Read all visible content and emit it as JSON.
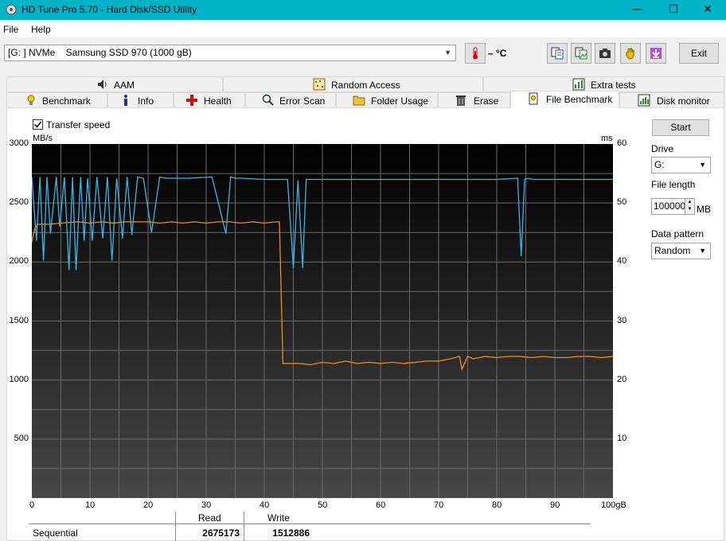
{
  "window": {
    "title": "HD Tune Pro 5.70 - Hard Disk/SSD Utility"
  },
  "menu": [
    "File",
    "Help"
  ],
  "toolbar": {
    "drive": "[G: ] NVMe    Samsung SSD 970 (1000 gB)",
    "temperature": "– °C",
    "exit_label": "Exit",
    "icons": [
      "thermometer-icon",
      "copy-text-icon",
      "copy-image-icon",
      "screenshot-icon",
      "hand-icon",
      "save-icon"
    ]
  },
  "tabs": {
    "row1": [
      {
        "label": "AAM",
        "icon": "speaker-icon"
      },
      {
        "label": "Random Access",
        "icon": "random-access-icon"
      },
      {
        "label": "Extra tests",
        "icon": "extra-tests-icon"
      }
    ],
    "row2": [
      {
        "label": "Benchmark",
        "icon": "benchmark-icon"
      },
      {
        "label": "Info",
        "icon": "info-icon"
      },
      {
        "label": "Health",
        "icon": "health-icon"
      },
      {
        "label": "Error Scan",
        "icon": "error-scan-icon"
      },
      {
        "label": "Folder Usage",
        "icon": "folder-icon"
      },
      {
        "label": "Erase",
        "icon": "erase-icon"
      },
      {
        "label": "File Benchmark",
        "icon": "file-benchmark-icon",
        "active": true
      },
      {
        "label": "Disk monitor",
        "icon": "disk-monitor-icon"
      }
    ]
  },
  "options": {
    "transfer_speed_label": "Transfer speed",
    "transfer_speed_checked": true
  },
  "side": {
    "start_label": "Start",
    "drive_label": "Drive",
    "drive_value": "G:",
    "file_length_label": "File length",
    "file_length_value": "100000",
    "file_length_unit": "MB",
    "pattern_label": "Data pattern",
    "pattern_value": "Random"
  },
  "chart_data": {
    "type": "line",
    "title": "",
    "left_unit": "MB/s",
    "right_unit": "ms",
    "x_unit": "gB",
    "ylim": [
      0,
      3000
    ],
    "y_right_lim": [
      0,
      60
    ],
    "xlim": [
      0,
      100
    ],
    "y_ticks": [
      3000,
      2500,
      2000,
      1500,
      1000,
      500
    ],
    "y_right_ticks": [
      60,
      50,
      40,
      30,
      20,
      10
    ],
    "x_ticks": [
      "0",
      "10",
      "20",
      "30",
      "40",
      "50",
      "60",
      "70",
      "80",
      "90",
      "100gB"
    ],
    "grid": true,
    "colors": {
      "read": "#3ab4e6",
      "write": "#f08c1e",
      "background_top": "#000000",
      "background_bottom": "#474747"
    },
    "series": [
      {
        "key": "read",
        "x": [
          0,
          0.8,
          1.4,
          2,
          2.6,
          3.2,
          4.2,
          4.8,
          5.6,
          6.4,
          7,
          7.6,
          8.4,
          9,
          9.6,
          10.4,
          11.2,
          12.2,
          13,
          13.8,
          14.6,
          15.6,
          16.4,
          17.2,
          18.2,
          19.2,
          20.6,
          22,
          23,
          24,
          27,
          31,
          33.4,
          34.2,
          35,
          36,
          40,
          44,
          45,
          45.8,
          46.6,
          47.2,
          50,
          60,
          70,
          80,
          83.6,
          84.2,
          84.8,
          85.4,
          86.2,
          90,
          100
        ],
        "values": [
          2720,
          2180,
          2720,
          2010,
          2720,
          2240,
          2720,
          2300,
          2720,
          1930,
          2720,
          1930,
          2720,
          2180,
          2710,
          2180,
          2720,
          2200,
          2720,
          2010,
          2710,
          2200,
          2720,
          2230,
          2720,
          2710,
          2250,
          2720,
          2710,
          2710,
          2710,
          2720,
          2240,
          2720,
          2710,
          2710,
          2700,
          2700,
          1950,
          2690,
          1950,
          2700,
          2700,
          2700,
          2700,
          2700,
          2710,
          2050,
          2700,
          2710,
          2700,
          2700,
          2700
        ]
      },
      {
        "key": "write",
        "x": [
          0,
          0.5,
          1,
          3,
          5,
          8,
          10,
          12,
          14,
          16,
          18,
          20,
          22,
          24,
          26,
          28,
          30,
          32,
          34,
          36,
          38,
          40,
          42,
          42.6,
          43.2,
          44,
          46,
          48,
          50,
          52,
          54,
          56,
          58,
          60,
          62,
          64,
          66,
          68,
          70,
          72,
          73.6,
          74,
          75,
          76,
          78,
          80,
          82,
          84,
          86,
          88,
          90,
          92,
          94,
          96,
          98,
          100
        ],
        "values": [
          2170,
          2280,
          2320,
          2320,
          2330,
          2340,
          2330,
          2340,
          2330,
          2340,
          2340,
          2340,
          2330,
          2340,
          2330,
          2340,
          2330,
          2340,
          2340,
          2330,
          2340,
          2330,
          2340,
          2340,
          1140,
          1140,
          1140,
          1130,
          1150,
          1140,
          1160,
          1140,
          1150,
          1140,
          1150,
          1140,
          1150,
          1160,
          1160,
          1180,
          1200,
          1090,
          1200,
          1180,
          1200,
          1190,
          1200,
          1200,
          1190,
          1200,
          1190,
          1190,
          1200,
          1200,
          1190,
          1200
        ]
      }
    ]
  },
  "results": {
    "head_read": "Read",
    "head_write": "Write",
    "row_label": "Sequential",
    "read_value": "2675173",
    "write_value": "1512886"
  }
}
